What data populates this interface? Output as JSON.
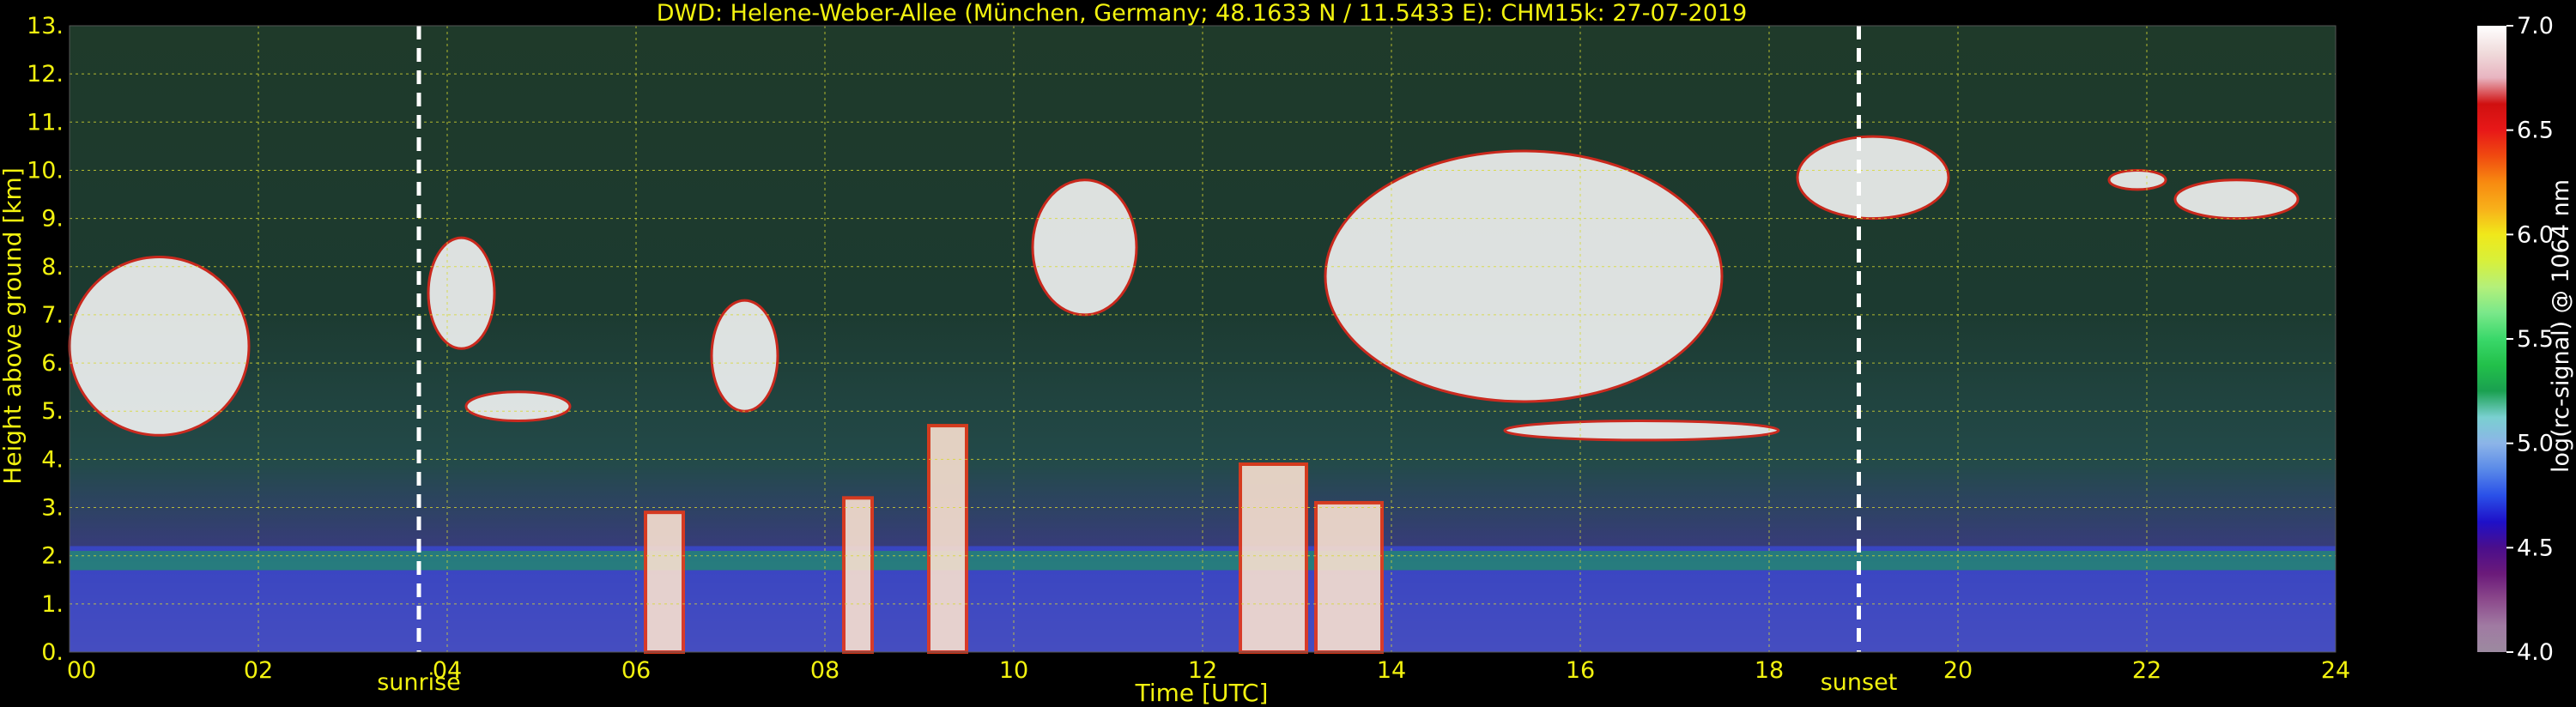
{
  "chart_data": {
    "type": "heatmap",
    "title": "DWD: Helene-Weber-Allee (München, Germany; 48.1633 N / 11.5433 E):    CHM15k: 27-07-2019",
    "xlabel": "Time [UTC]",
    "ylabel": "Height above ground [km]",
    "xlim": [
      0,
      24
    ],
    "ylim": [
      0,
      13
    ],
    "x_ticks": [
      "00",
      "02",
      "04",
      "06",
      "08",
      "10",
      "12",
      "14",
      "16",
      "18",
      "20",
      "22",
      "24"
    ],
    "y_ticks": [
      "0.",
      "1.",
      "2.",
      "3.",
      "4.",
      "5.",
      "6.",
      "7.",
      "8.",
      "9.",
      "10.",
      "11.",
      "12.",
      "13."
    ],
    "grid": true,
    "colorbar": {
      "label": "log(rc-signal) @ 1064 nm",
      "range": [
        4.0,
        7.0
      ],
      "ticks": [
        "4.0",
        "4.5",
        "5.0",
        "5.5",
        "6.0",
        "6.5",
        "7.0"
      ],
      "colors": [
        "#9c8aa0",
        "#a07aa2",
        "#8c4a8c",
        "#6b1a7a",
        "#4a0e8c",
        "#1e10c8",
        "#2a50e8",
        "#5a8ae8",
        "#8cb4e8",
        "#7ad0d0",
        "#1aa050",
        "#22c04a",
        "#3ad86a",
        "#7ae88a",
        "#b4f07a",
        "#d8f03a",
        "#f0e81a",
        "#f8b01a",
        "#f88a10",
        "#f04a10",
        "#e81818",
        "#d01010",
        "#e8b4c0",
        "#f0dcdc",
        "#ffffff"
      ]
    },
    "events": [
      {
        "label": "sunrise",
        "time": 3.7
      },
      {
        "label": "sunset",
        "time": 18.95
      }
    ],
    "features": [
      {
        "type": "aerosol_layer",
        "t_start": 0,
        "t_end": 24,
        "h_bottom": 0.0,
        "h_top": 2.2
      },
      {
        "type": "cloud",
        "t_start": 0.0,
        "t_end": 1.9,
        "h_bottom": 4.5,
        "h_top": 8.2
      },
      {
        "type": "cloud",
        "t_start": 3.8,
        "t_end": 4.5,
        "h_bottom": 6.3,
        "h_top": 8.6
      },
      {
        "type": "cloud",
        "t_start": 4.2,
        "t_end": 5.3,
        "h_bottom": 4.8,
        "h_top": 5.4
      },
      {
        "type": "cloud",
        "t_start": 6.8,
        "t_end": 7.5,
        "h_bottom": 5.0,
        "h_top": 7.3
      },
      {
        "type": "cloud",
        "t_start": 10.2,
        "t_end": 11.3,
        "h_bottom": 7.0,
        "h_top": 9.8
      },
      {
        "type": "cloud",
        "t_start": 13.3,
        "t_end": 17.5,
        "h_bottom": 5.2,
        "h_top": 10.4
      },
      {
        "type": "cloud",
        "t_start": 18.3,
        "t_end": 19.9,
        "h_bottom": 9.0,
        "h_top": 10.7
      },
      {
        "type": "cloud",
        "t_start": 21.6,
        "t_end": 22.2,
        "h_bottom": 9.6,
        "h_top": 10.0
      },
      {
        "type": "cloud",
        "t_start": 22.3,
        "t_end": 23.6,
        "h_bottom": 9.0,
        "h_top": 9.8
      },
      {
        "type": "cloud",
        "t_start": 15.2,
        "t_end": 18.1,
        "h_bottom": 4.4,
        "h_top": 4.8
      },
      {
        "type": "rain",
        "t_start": 6.1,
        "t_end": 6.5,
        "h_bottom": 0.0,
        "h_top": 2.9
      },
      {
        "type": "rain",
        "t_start": 8.2,
        "t_end": 8.5,
        "h_bottom": 0.0,
        "h_top": 3.2
      },
      {
        "type": "rain",
        "t_start": 9.1,
        "t_end": 9.5,
        "h_bottom": 0.0,
        "h_top": 4.7
      },
      {
        "type": "rain",
        "t_start": 12.4,
        "t_end": 13.1,
        "h_bottom": 0.0,
        "h_top": 3.9
      },
      {
        "type": "rain",
        "t_start": 13.2,
        "t_end": 13.9,
        "h_bottom": 0.0,
        "h_top": 3.1
      }
    ]
  }
}
